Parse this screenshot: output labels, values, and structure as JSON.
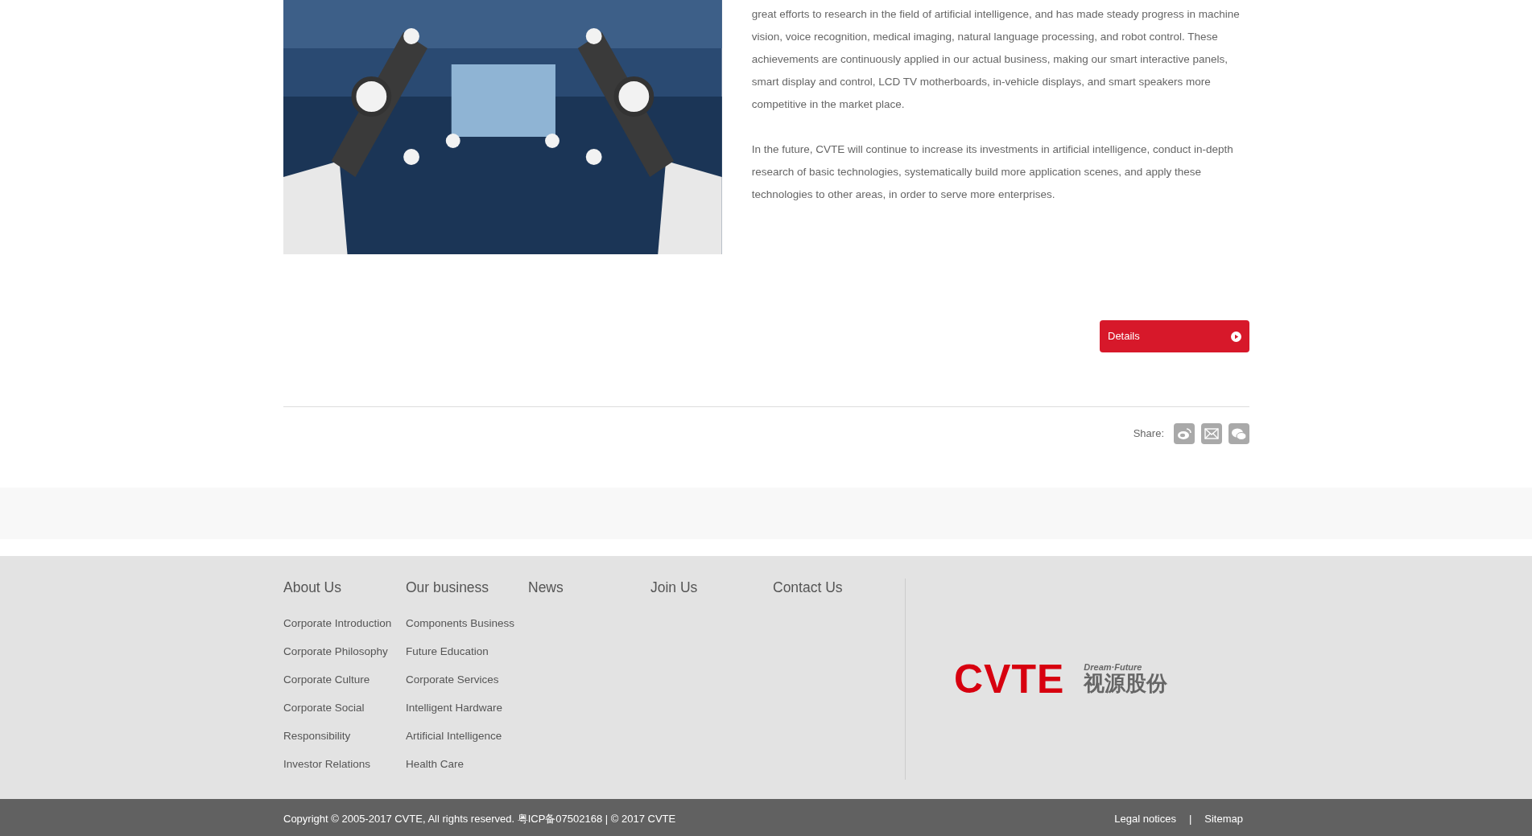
{
  "article": {
    "image": {
      "kind": "picture"
    },
    "paragraphs": [
      "great efforts to research in the field of artificial intelligence, and has made steady progress in machine vision, voice recognition, medical imaging, natural language processing, and robot control. These achievements are continuously applied in our actual business, making our smart interactive panels, smart display and control, LCD TV motherboards, in-vehicle displays, and smart speakers more competitive in the market place.",
      "In the future, CVTE will continue to increase its investments in artificial intelligence, conduct in-depth research of basic technologies, systematically build more application scenes, and apply these technologies to other areas, in order to serve more enterprises."
    ],
    "details_button": "Details",
    "share": {
      "label": "Share:",
      "icons": [
        {
          "kind": "weibo"
        },
        {
          "kind": "mail"
        },
        {
          "kind": "wechat"
        }
      ]
    }
  },
  "footer": {
    "columns": [
      {
        "heading": "About Us",
        "links": [
          "Corporate Introduction",
          "Corporate Philosophy",
          "Corporate Culture",
          "Corporate Social",
          "Responsibility",
          "Investor Relations"
        ]
      },
      {
        "heading": "Our business",
        "links": [
          "Components Business",
          "Future Education",
          "Corporate Services",
          "Intelligent Hardware",
          "Artificial Intelligence",
          "Health Care"
        ]
      },
      {
        "heading": "News"
      },
      {
        "heading": "Join Us"
      },
      {
        "heading": "Contact Us"
      }
    ],
    "logo": {
      "mark": "CVTE",
      "slogan": "Dream·Future",
      "name": "视源股份"
    }
  },
  "bottom_bar": {
    "copyright": "Copyright © 2005-2017 CVTE, All rights reserved. 粤ICP备07502168 | © 2017 CVTE",
    "links": [
      "Legal notices",
      "Sitemap"
    ],
    "separator": "|"
  }
}
